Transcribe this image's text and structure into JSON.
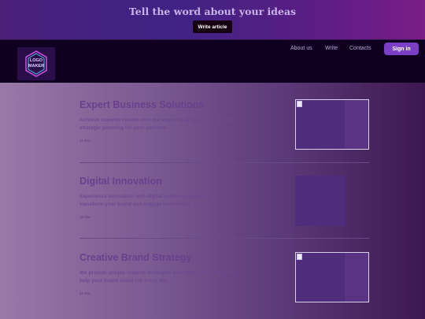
{
  "banner": {
    "title": "Tell the word about your ideas",
    "cta_label": "Write article"
  },
  "navbar": {
    "logo_text_line1": "LOGO",
    "logo_text_line2": "MAKER",
    "links": [
      "About us",
      "Write",
      "Contacts"
    ],
    "signin_label": "Sign in"
  },
  "articles": [
    {
      "title": "Expert Business Solutions",
      "description": "Achieve superior results with our expert business solutions and strategic planning for your success.",
      "date": "11 Dec"
    },
    {
      "title": "Digital Innovation",
      "description": "Experience innovation with digital solutions designed to transform your brand and engage customers!",
      "date": "16 Dec"
    },
    {
      "title": "Creative Brand Strategy",
      "description": "We provide unique creative strategies and high-quality design to help your brand stand out every day",
      "date": "21 Dec"
    }
  ],
  "colors": {
    "accent": "#7a3fc4",
    "navbar_bg": "#10001f"
  }
}
